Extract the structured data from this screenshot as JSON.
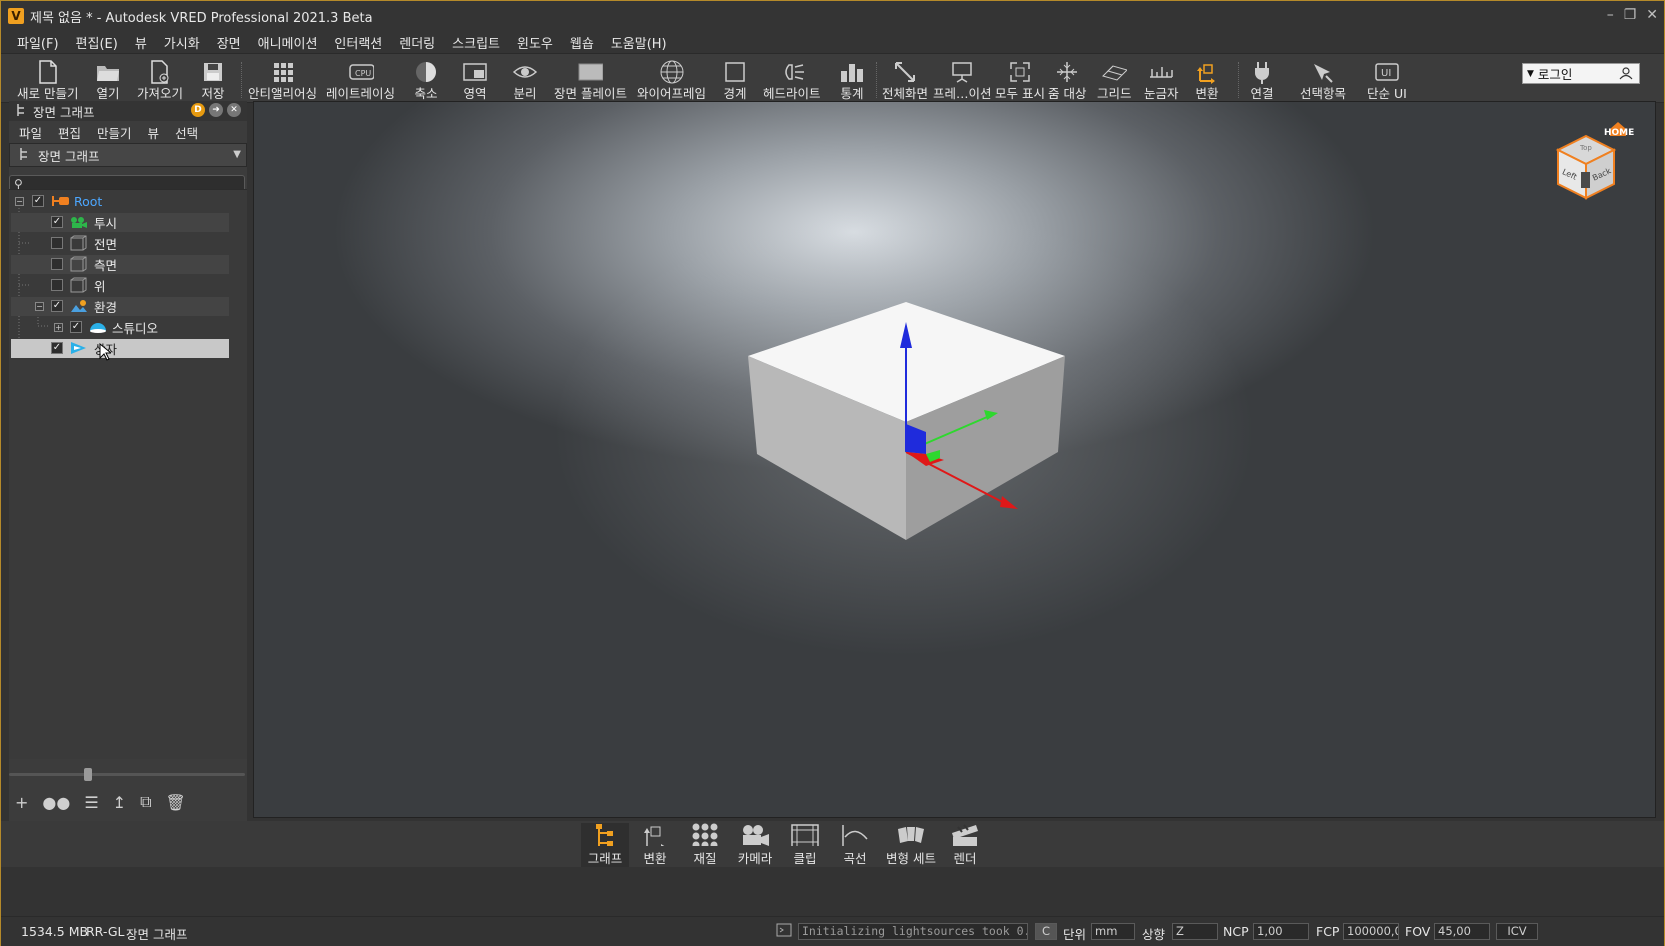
{
  "window": {
    "title": "제목 없음 * - Autodesk VRED Professional 2021.3 Beta",
    "app_icon": "V"
  },
  "menu": [
    "파일(F)",
    "편집(E)",
    "뷰",
    "가시화",
    "장면",
    "애니메이션",
    "인터랙션",
    "렌더링",
    "스크립트",
    "윈도우",
    "웹숍",
    "도움말(H)"
  ],
  "toolbar": {
    "items": [
      {
        "label": "새로 만들기",
        "icon": "new-file-icon"
      },
      {
        "label": "열기",
        "icon": "open-folder-icon"
      },
      {
        "label": "가져오기",
        "icon": "import-icon"
      },
      {
        "label": "저장",
        "icon": "save-icon"
      },
      {
        "label": "안티앨리어싱",
        "icon": "antialiasing-icon"
      },
      {
        "label": "레이트레이싱",
        "icon": "cpu-icon"
      },
      {
        "label": "축소",
        "icon": "contrast-icon"
      },
      {
        "label": "영역",
        "icon": "region-icon"
      },
      {
        "label": "분리",
        "icon": "eye-icon"
      },
      {
        "label": "장면 플레이트",
        "icon": "scene-plate-icon"
      },
      {
        "label": "와이어프레임",
        "icon": "wireframe-icon"
      },
      {
        "label": "경계",
        "icon": "bounds-icon"
      },
      {
        "label": "헤드라이트",
        "icon": "headlight-icon"
      },
      {
        "label": "통계",
        "icon": "statistics-icon"
      },
      {
        "label": "전체화면",
        "icon": "fullscreen-icon"
      },
      {
        "label": "프레…이션",
        "icon": "presentation-icon"
      },
      {
        "label": "모두 표시",
        "icon": "show-all-icon"
      },
      {
        "label": "줌 대상",
        "icon": "zoom-target-icon"
      },
      {
        "label": "그리드",
        "icon": "grid-icon"
      },
      {
        "label": "눈금자",
        "icon": "ruler-icon"
      },
      {
        "label": "변환",
        "icon": "transform-icon"
      },
      {
        "label": "연결",
        "icon": "plug-icon"
      },
      {
        "label": "선택항목",
        "icon": "selection-icon"
      },
      {
        "label": "단순 UI",
        "icon": "ui-icon"
      }
    ],
    "login_label": "로그인"
  },
  "panel": {
    "title": "장면 그래프",
    "menu": [
      "파일",
      "편집",
      "만들기",
      "뷰",
      "선택"
    ],
    "dropdown": "장면 그래프",
    "search_placeholder": "",
    "tree": [
      {
        "label": "Root",
        "checked": true
      },
      {
        "label": "투시",
        "checked": true
      },
      {
        "label": "전면",
        "checked": false
      },
      {
        "label": "측면",
        "checked": false
      },
      {
        "label": "위",
        "checked": false
      },
      {
        "label": "환경",
        "checked": true
      },
      {
        "label": "스튜디오",
        "checked": true
      },
      {
        "label": "상자",
        "checked": true
      }
    ]
  },
  "viewcube": {
    "home_label": "HOME",
    "faces": [
      "Left",
      "Back",
      "Top"
    ]
  },
  "dock": [
    {
      "label": "그래프",
      "icon": "graph-icon"
    },
    {
      "label": "변환",
      "icon": "transform-icon"
    },
    {
      "label": "재질",
      "icon": "materials-icon"
    },
    {
      "label": "카메라",
      "icon": "camera-icon"
    },
    {
      "label": "클립",
      "icon": "clip-icon"
    },
    {
      "label": "곡선",
      "icon": "curve-icon"
    },
    {
      "label": "변형 세트",
      "icon": "variant-sets-icon"
    },
    {
      "label": "렌더",
      "icon": "render-icon"
    }
  ],
  "status": {
    "memory": "1534.5 MB",
    "renderer": "RR-GL",
    "module": "장면 그래프",
    "log": "Initializing lightsources took 0...",
    "c_button": "C",
    "unit_label": "단위",
    "unit_value": "mm",
    "up_label": "상향",
    "up_value": "Z",
    "ncp_label": "NCP",
    "ncp_value": "1,00",
    "fcp_label": "FCP",
    "fcp_value": "100000,00",
    "fov_label": "FOV",
    "fov_value": "45,00",
    "icv": "ICV"
  }
}
